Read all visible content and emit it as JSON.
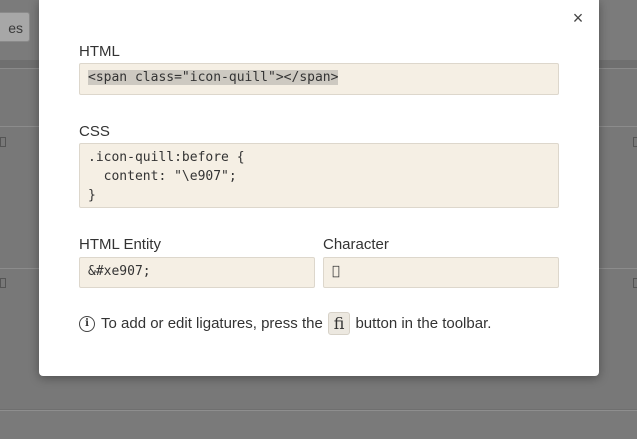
{
  "background": {
    "button_label": "es"
  },
  "modal": {
    "close_label": "×",
    "html": {
      "label": "HTML",
      "value": "<span class=\"icon-quill\"></span>"
    },
    "css": {
      "label": "CSS",
      "value": ".icon-quill:before {\n  content: \"\\e907\";\n}"
    },
    "entity": {
      "label": "HTML Entity",
      "value": "&#xe907;"
    },
    "character": {
      "label": "Character",
      "value": ""
    },
    "info": {
      "icon": "info-icon",
      "text_before": "To add or edit ligatures, press the",
      "key_label": "ﬁ",
      "text_after": "button in the toolbar."
    }
  },
  "colors": {
    "overlay": "#6f6f6f",
    "field_bg": "#f5efe4",
    "selection_bg": "#cdc9c1"
  }
}
